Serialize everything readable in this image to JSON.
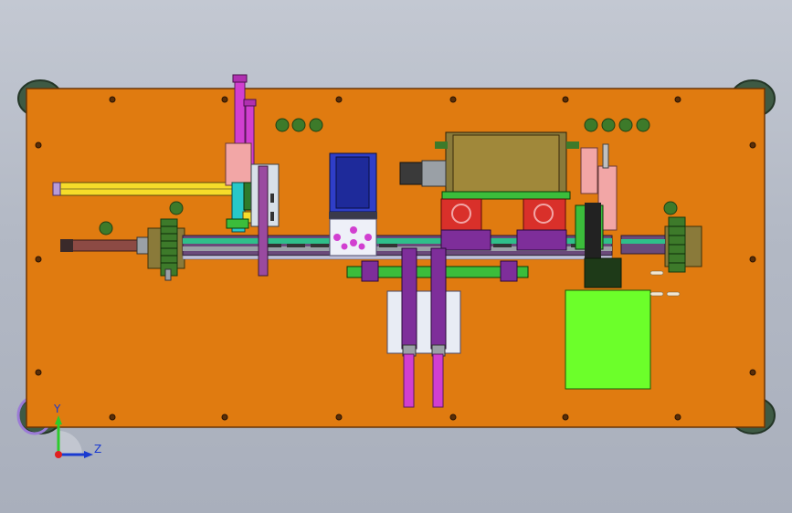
{
  "viewport": {
    "background_top": "#c3c8d2",
    "background_bottom": "#a9afbc"
  },
  "colors": {
    "base_plate": "#e07b10",
    "plate_edge": "#6a3405",
    "frame_foot": "#3e5a44",
    "slot": "#7a4a86",
    "magenta": "#d13fd0",
    "purple": "#7e2e9a",
    "blue": "#2f3ec8",
    "green_light": "#7bff2a",
    "green_mid": "#3bbd3b",
    "olive": "#8a7a3a",
    "red": "#d9302a",
    "pink": "#f2a6a6",
    "yellow": "#f6dc2a",
    "gray": "#9aa0a6",
    "dark_gray": "#4a4a4a",
    "cyan": "#28c8c8"
  },
  "triad": {
    "y_label": "Y",
    "z_label": "Z",
    "y_color": "#2ccb2c",
    "z_color": "#1a3ad0",
    "origin_color": "#e02020"
  }
}
